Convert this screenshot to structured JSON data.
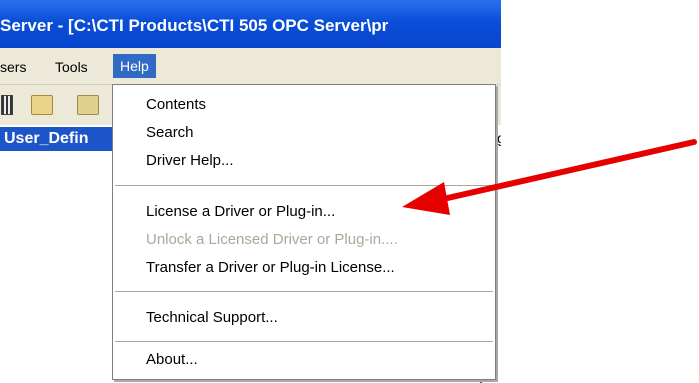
{
  "window": {
    "title": "Server - [C:\\CTI Products\\CTI 505 OPC Server\\pr"
  },
  "menubar": {
    "items": [
      {
        "label": "sers"
      },
      {
        "label": "Tools"
      },
      {
        "label": "Help"
      }
    ]
  },
  "toolbar": {
    "icons": [
      "tree-icon",
      "open-folder-icon",
      "folder-icon"
    ]
  },
  "tree": {
    "header": "User_Defin"
  },
  "content": {
    "fragment": "ig"
  },
  "help_menu": {
    "items": [
      {
        "label": "Contents",
        "enabled": true
      },
      {
        "label": "Search",
        "enabled": true
      },
      {
        "label": "Driver Help...",
        "enabled": true
      },
      {
        "label": "License a Driver or Plug-in...",
        "enabled": true
      },
      {
        "label": "Unlock a Licensed Driver or Plug-in....",
        "enabled": false
      },
      {
        "label": "Transfer a Driver or Plug-in License...",
        "enabled": true
      },
      {
        "label": "Technical Support...",
        "enabled": true
      },
      {
        "label": "About...",
        "enabled": true
      }
    ]
  },
  "colors": {
    "title_bar": "#0a4ed8",
    "menu_highlight": "#316ac5",
    "disabled_text": "#aca899",
    "annotation_arrow": "#e60000"
  }
}
